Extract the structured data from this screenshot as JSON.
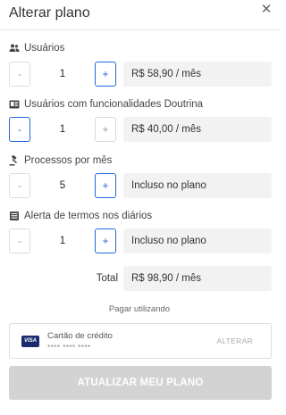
{
  "header": {
    "title": "Alterar plano",
    "close_glyph": "✕"
  },
  "sections": [
    {
      "label": "Usuários",
      "icon": "users-icon",
      "qty": "1",
      "price": "R$ 58,90 / mês",
      "minus_active": false,
      "plus_active": true
    },
    {
      "label": "Usuários com funcionalidades Doutrina",
      "icon": "book-icon",
      "qty": "1",
      "price": "R$ 40,00 / mês",
      "minus_active": true,
      "plus_active": false
    },
    {
      "label": "Processos por mês",
      "icon": "gavel-icon",
      "qty": "5",
      "price": "Incluso no plano",
      "minus_active": false,
      "plus_active": true
    },
    {
      "label": "Alerta de termos nos diários",
      "icon": "newspaper-icon",
      "qty": "1",
      "price": "Incluso no plano",
      "minus_active": false,
      "plus_active": true
    }
  ],
  "controls": {
    "minus": "-",
    "plus": "+"
  },
  "total": {
    "label": "Total",
    "value": "R$ 98,90 / mês"
  },
  "payment": {
    "caption": "Pagar utilizando",
    "card_brand": "VISA",
    "card_name": "Cartão de crédito",
    "card_number": "**** **** ****",
    "change_label": "ALTERAR"
  },
  "submit": {
    "label": "ATUALIZAR MEU PLANO"
  },
  "colors": {
    "accent": "#1e6bd6",
    "disabled_button": "#d3d3d3",
    "field_bg": "#f2f2f2"
  }
}
